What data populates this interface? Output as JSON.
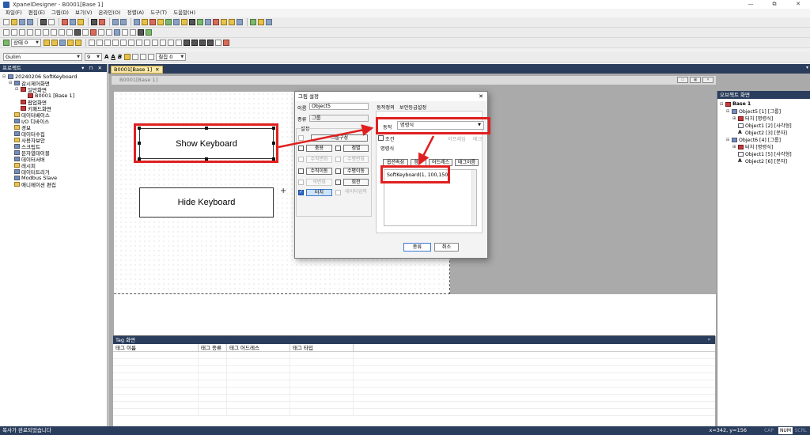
{
  "window": {
    "title": "XpanelDesigner - B0001[Base 1]",
    "controls": [
      "—",
      "⧉",
      "✕"
    ]
  },
  "menu": [
    "파일(F)",
    "편집(E)",
    "그림(D)",
    "보기(V)",
    "온라인(O)",
    "정렬(A)",
    "도구(T)",
    "도움말(H)"
  ],
  "toolbar3": {
    "state_combo": "상태 0"
  },
  "toolbar4": {
    "font_combo": "Gulim",
    "size_combo": "9",
    "bold": "A",
    "italic": "A",
    "align_label": "B",
    "layer_combo": "칠칩 0"
  },
  "project_panel": {
    "title": "프로젝트",
    "controls": "▾ ⊓ ✕",
    "items": [
      {
        "label": "20240206 SoftKeyboard",
        "toggle": "⊟"
      },
      {
        "label": "감시제어화면",
        "toggle": "⊟"
      },
      {
        "label": "일반화면",
        "toggle": "⊟"
      },
      {
        "label": "B0001 [Base 1]",
        "toggle": ""
      },
      {
        "label": "팝업화면",
        "toggle": ""
      },
      {
        "label": "키패드화면",
        "toggle": ""
      },
      {
        "label": "데이터베이스",
        "toggle": ""
      },
      {
        "label": "I/O 디바이스",
        "toggle": ""
      },
      {
        "label": "경보",
        "toggle": ""
      },
      {
        "label": "데이터수집",
        "toggle": ""
      },
      {
        "label": "사용자보안",
        "toggle": ""
      },
      {
        "label": "스크립트",
        "toggle": ""
      },
      {
        "label": "문자열테이블",
        "toggle": ""
      },
      {
        "label": "데이터서버",
        "toggle": ""
      },
      {
        "label": "레시피",
        "toggle": ""
      },
      {
        "label": "데이터트리거",
        "toggle": ""
      },
      {
        "label": "Modbus Slave",
        "toggle": ""
      },
      {
        "label": "애니메이션 편집",
        "toggle": ""
      }
    ]
  },
  "doc": {
    "tab_label": "B0001[Base 1]",
    "tab_close": "✕",
    "inner_title": "B0001[Base 1]",
    "inner_controls": [
      "▭",
      "▣",
      "✕"
    ],
    "tab_arrow": "▾"
  },
  "canvas": {
    "show_button": "Show Keyboard",
    "hide_button": "Hide Keyboard",
    "cursor": "+"
  },
  "dialog": {
    "title": "그림 설정",
    "close": "✕",
    "name_label": "이름",
    "name_value": "Object5",
    "type_label": "종류",
    "type_value": "그룹",
    "settings_label": "설정",
    "group_config_btn": "그룹구성",
    "options": [
      {
        "label": "충용",
        "checked": false,
        "disabled": false
      },
      {
        "label": "점멸",
        "checked": false,
        "disabled": false
      },
      {
        "label": "수직변화",
        "checked": false,
        "disabled": true
      },
      {
        "label": "수평변화",
        "checked": false,
        "disabled": true
      },
      {
        "label": "수직이동",
        "checked": false,
        "disabled": false
      },
      {
        "label": "수평이동",
        "checked": false,
        "disabled": false
      },
      {
        "label": "색변화",
        "checked": false,
        "disabled": true
      },
      {
        "label": "회전",
        "checked": false,
        "disabled": false
      },
      {
        "label": "터치",
        "checked": true,
        "disabled": false
      },
      {
        "label": "데이터입력",
        "checked": false,
        "disabled": true
      }
    ],
    "tabs": [
      "동작정의",
      "보안등급설정"
    ],
    "action_label": "동작",
    "action_value": "명령식",
    "check_label": "조건",
    "check_extra": "이프레임",
    "check_extra2": "매크",
    "command_group_label": "명령식",
    "command_btns": [
      "옵션속성",
      "함수",
      "어드레스",
      "태그이름"
    ],
    "command_text": "SoftKeyboard(1, 100,150)",
    "ok": "종류",
    "cancel": "취소"
  },
  "object_panel": {
    "title": "오브젝트 화면",
    "items": [
      {
        "label": "Base 1",
        "toggle": "⊟",
        "indent": 0
      },
      {
        "label": "Object5 [1] [그룹]",
        "toggle": "⊟",
        "indent": 1
      },
      {
        "label": "터치 [명령식]",
        "toggle": "⊞",
        "indent": 2
      },
      {
        "label": "Object1 [2] [사각형]",
        "toggle": "",
        "indent": 2
      },
      {
        "label": "Object2 [3] [문자]",
        "toggle": "",
        "indent": 2
      },
      {
        "label": "Object6 [4] [그룹]",
        "toggle": "⊟",
        "indent": 1
      },
      {
        "label": "터치 [명령식]",
        "toggle": "⊞",
        "indent": 2
      },
      {
        "label": "Object1 [5] [사각형]",
        "toggle": "",
        "indent": 2
      },
      {
        "label": "Object2 [6] [문자]",
        "toggle": "",
        "indent": 2
      }
    ]
  },
  "tag_panel": {
    "title": "Tag 화면",
    "pin": "ᵖ",
    "columns": [
      "태그 이름",
      "태그 종류",
      "태그 어드레스",
      "태그 타입"
    ]
  },
  "status": {
    "message": "복사가 완료되었습니다",
    "coords": "x=342, y=156",
    "cap": "CAP",
    "num": "NUM",
    "scrl": "SCRL"
  },
  "colors": {
    "panel_header": "#2a3d5c",
    "highlight": "#e02020",
    "accent": "#2b6cc8"
  }
}
